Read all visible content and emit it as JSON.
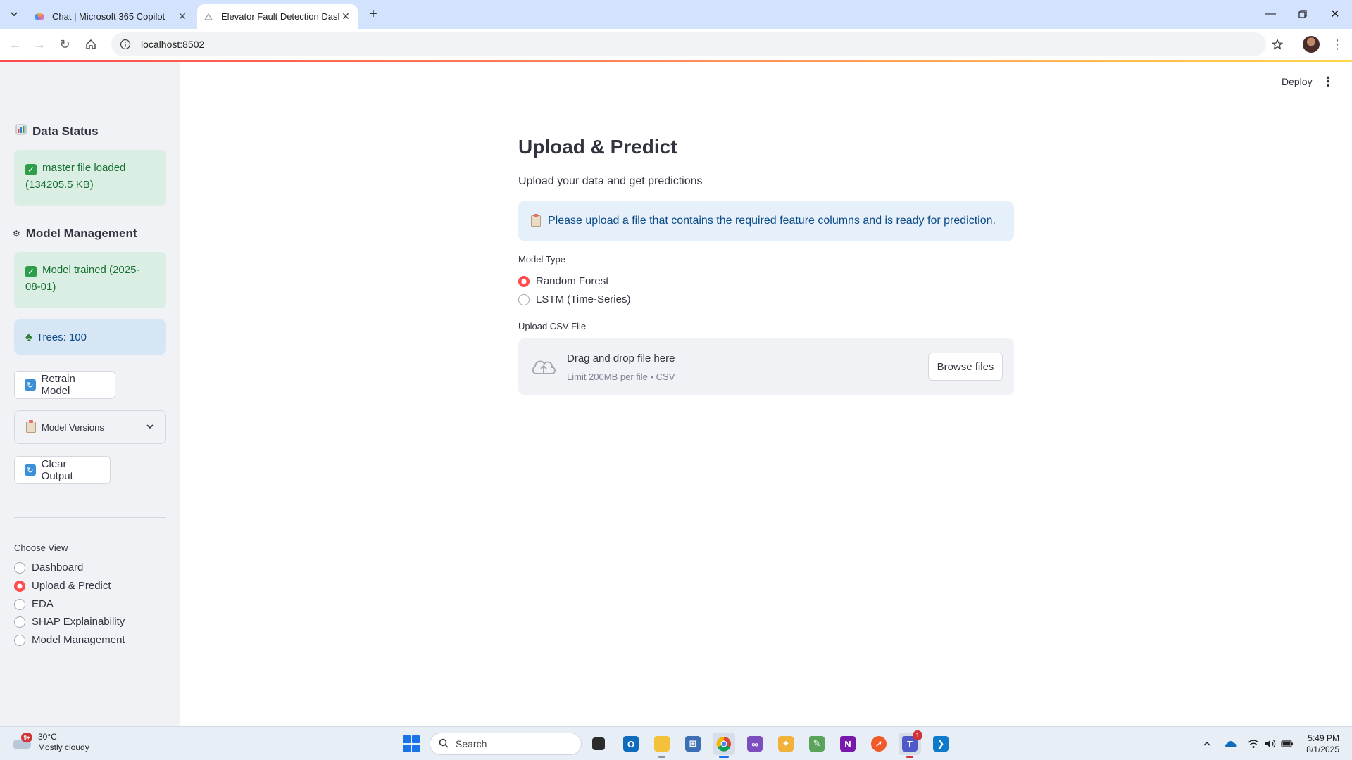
{
  "browser": {
    "tabs": [
      {
        "title": "Chat | Microsoft 365 Copilot",
        "active": false
      },
      {
        "title": "Elevator Fault Detection Dashbo",
        "active": true
      }
    ],
    "url": "localhost:8502"
  },
  "colors": {
    "accent": "#ff4b4b",
    "success_bg": "#dbeee3",
    "success_text": "#177233",
    "info_bg": "#d6e6f5",
    "info_text": "#0c4a86"
  },
  "sidebar": {
    "data_status": {
      "heading": "Data Status",
      "status_text": "master file loaded (134205.5 KB)"
    },
    "model_management": {
      "heading": "Model Management",
      "trained_text": "Model trained (2025-08-01)",
      "trees_text": "Trees: 100",
      "retrain_label": "Retrain Model",
      "versions_label": "Model Versions",
      "clear_label": "Clear Output"
    },
    "choose_view": {
      "label": "Choose View",
      "options": [
        "Dashboard",
        "Upload & Predict",
        "EDA",
        "SHAP Explainability",
        "Model Management"
      ],
      "selected": "Upload & Predict"
    }
  },
  "main": {
    "header": {
      "deploy_label": "Deploy"
    },
    "title": "Upload & Predict",
    "subtitle": "Upload your data and get predictions",
    "info_message": "Please upload a file that contains the required feature columns and is ready for prediction.",
    "model_type": {
      "label": "Model Type",
      "options": [
        "Random Forest",
        "LSTM (Time-Series)"
      ],
      "selected": "Random Forest"
    },
    "uploader": {
      "label": "Upload CSV File",
      "drop_text": "Drag and drop file here",
      "limit_text": "Limit 200MB per file • CSV",
      "browse_label": "Browse files"
    }
  },
  "taskbar": {
    "weather_temp": "30°C",
    "weather_desc": "Mostly cloudy",
    "weather_badge": "9+",
    "search_placeholder": "Search",
    "teams_badge": "1",
    "time": "5:49 PM",
    "date": "8/1/2025"
  }
}
